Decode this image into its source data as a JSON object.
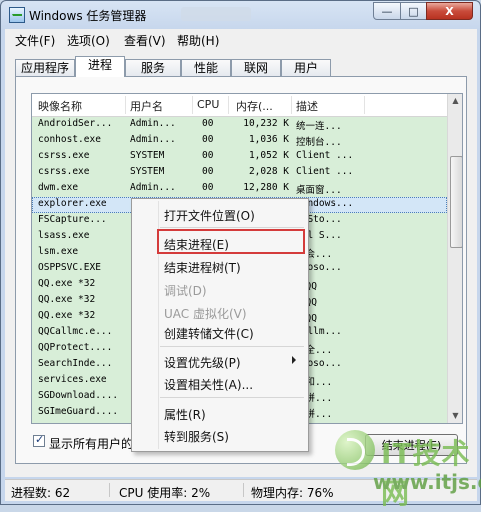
{
  "window": {
    "title": "Windows 任务管理器",
    "buttons": {
      "minimize": "—",
      "maximize": "□",
      "close": "X"
    }
  },
  "menubar": [
    "文件(F)",
    "选项(O)",
    "查看(V)",
    "帮助(H)"
  ],
  "tabs": [
    {
      "label": "应用程序",
      "active": false
    },
    {
      "label": "进程",
      "active": true
    },
    {
      "label": "服务",
      "active": false
    },
    {
      "label": "性能",
      "active": false
    },
    {
      "label": "联网",
      "active": false
    },
    {
      "label": "用户",
      "active": false
    }
  ],
  "columns": [
    "映像名称",
    "用户名",
    "CPU",
    "内存(...",
    "描述"
  ],
  "processes": [
    {
      "image": "AndroidSer...",
      "user": "Admin...",
      "cpu": "00",
      "memory": "10,232 K",
      "desc": "统一连..."
    },
    {
      "image": "conhost.exe",
      "user": "Admin...",
      "cpu": "00",
      "memory": "1,036 K",
      "desc": "控制台..."
    },
    {
      "image": "csrss.exe",
      "user": "SYSTEM",
      "cpu": "00",
      "memory": "1,052 K",
      "desc": "Client ..."
    },
    {
      "image": "csrss.exe",
      "user": "SYSTEM",
      "cpu": "00",
      "memory": "2,028 K",
      "desc": "Client ..."
    },
    {
      "image": "dwm.exe",
      "user": "Admin...",
      "cpu": "00",
      "memory": "12,280 K",
      "desc": "桌面窗..."
    },
    {
      "image": "explorer.exe",
      "user": "",
      "cpu": "",
      "memory": "",
      "desc": "Windows..."
    },
    {
      "image": "FSCapture...",
      "user": "",
      "cpu": "",
      "memory": "",
      "desc": "stSto..."
    },
    {
      "image": "lsass.exe",
      "user": "",
      "cpu": "",
      "memory": "",
      "desc": "cal S..."
    },
    {
      "image": "lsm.exe",
      "user": "",
      "cpu": "",
      "memory": "",
      "desc": "地会..."
    },
    {
      "image": "OSPPSVC.EXE",
      "user": "",
      "cpu": "",
      "memory": "",
      "desc": "crosо..."
    },
    {
      "image": "QQ.exe *32",
      "user": "",
      "cpu": "",
      "memory": "",
      "desc": "讯QQ"
    },
    {
      "image": "QQ.exe *32",
      "user": "",
      "cpu": "",
      "memory": "",
      "desc": "讯QQ"
    },
    {
      "image": "QQ.exe *32",
      "user": "",
      "cpu": "",
      "memory": "",
      "desc": "讯QQ"
    },
    {
      "image": "QQCallmc.e...",
      "user": "",
      "cpu": "",
      "memory": "",
      "desc": "Callm..."
    },
    {
      "image": "QQProtect....",
      "user": "",
      "cpu": "",
      "memory": "",
      "desc": "安全..."
    },
    {
      "image": "SearchInde...",
      "user": "",
      "cpu": "",
      "memory": "",
      "desc": "croso..."
    },
    {
      "image": "services.exe",
      "user": "",
      "cpu": "",
      "memory": "",
      "desc": "务和..."
    },
    {
      "image": "SGDownload....",
      "user": "",
      "cpu": "",
      "memory": "",
      "desc": "狗拼..."
    },
    {
      "image": "SGImeGuard....",
      "user": "",
      "cpu": "",
      "memory": "",
      "desc": "狗拼..."
    }
  ],
  "context_menu": {
    "items": [
      {
        "label": "打开文件位置(O)",
        "enabled": true
      },
      {
        "label": "结束进程(E)",
        "enabled": true,
        "highlighted": true
      },
      {
        "label": "结束进程树(T)",
        "enabled": true
      },
      {
        "label": "调试(D)",
        "enabled": false
      },
      {
        "label": "UAC 虚拟化(V)",
        "enabled": false
      },
      {
        "label": "创建转储文件(C)",
        "enabled": true
      },
      {
        "label": "设置优先级(P)",
        "enabled": true,
        "submenu": true
      },
      {
        "label": "设置相关性(A)...",
        "enabled": true
      },
      {
        "label": "属性(R)",
        "enabled": true
      },
      {
        "label": "转到服务(S)",
        "enabled": true
      }
    ]
  },
  "show_all_users_label": "显示所有用户的",
  "end_process_button": "结束进程(E)",
  "status": {
    "processes": "进程数: 62",
    "cpu": "CPU 使用率: 2%",
    "memory": "物理内存: 76%"
  },
  "watermark": {
    "brand": "IT技术网",
    "url": "www.itjs.cn"
  },
  "colors": {
    "list_bg": "#d8eed8",
    "highlight": "#d43b3b",
    "selection": "#d3e6f7"
  }
}
